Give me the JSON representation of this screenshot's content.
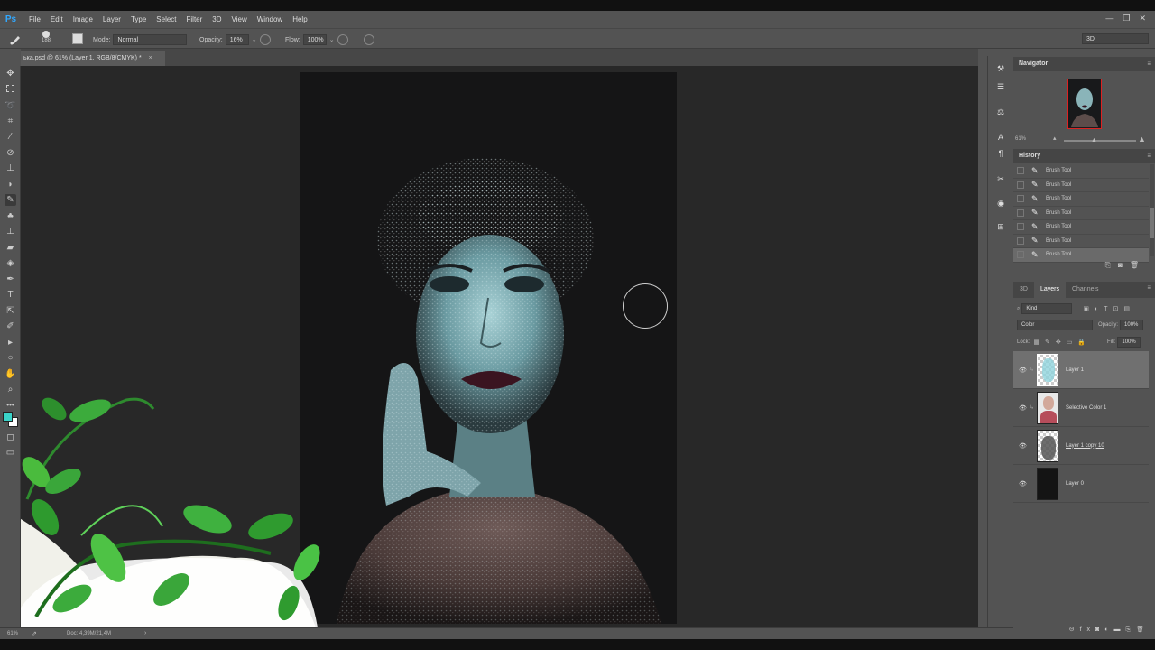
{
  "app": {
    "logo": "Ps"
  },
  "menu": [
    "File",
    "Edit",
    "Image",
    "Layer",
    "Type",
    "Select",
    "Filter",
    "3D",
    "View",
    "Window",
    "Help"
  ],
  "window_controls": {
    "minimize": "—",
    "restore": "❐",
    "close": "✕"
  },
  "options": {
    "brush_size": "188",
    "mode_label": "Mode:",
    "mode_value": "Normal",
    "opacity_label": "Opacity:",
    "opacity_value": "16%",
    "flow_label": "Flow:",
    "flow_value": "100%",
    "workspace": "3D"
  },
  "document_tab": {
    "title": "ька.psd @ 61% (Layer 1, RGB/8/CMYK) *",
    "close": "×"
  },
  "colors": {
    "foreground": "#3ad3c8",
    "background": "#ffffff",
    "accent_border": "#dd2222"
  },
  "status": {
    "zoom": "61%",
    "doc_info": "Doc: 4,39M/21,4M"
  },
  "navigator": {
    "title": "Navigator",
    "zoom": "61%"
  },
  "history": {
    "title": "History",
    "items": [
      "Brush Tool",
      "Brush Tool",
      "Brush Tool",
      "Brush Tool",
      "Brush Tool",
      "Brush Tool",
      "Brush Tool"
    ],
    "current_index": 6
  },
  "layers_panel": {
    "tabs": [
      "3D",
      "Layers",
      "Channels"
    ],
    "active_tab": "Layers",
    "filter_kind": "Kind",
    "blend_mode": "Color",
    "opacity_label": "Opacity:",
    "opacity_value": "100%",
    "lock_label": "Lock:",
    "fill_label": "Fill:",
    "fill_value": "100%",
    "layers": [
      {
        "name": "Layer 1",
        "selected": true
      },
      {
        "name": "Selective Color 1",
        "selected": false
      },
      {
        "name": "Layer 1 copy 10",
        "selected": false
      },
      {
        "name": "Layer 0",
        "selected": false
      }
    ]
  },
  "icons": {
    "tools": [
      "move-icon",
      "marquee-icon",
      "lasso-icon",
      "crop-icon",
      "eyedropper-icon",
      "spot-heal-icon",
      "brush-icon",
      "clone-stamp-icon",
      "history-brush-icon",
      "eraser-icon",
      "gradient-icon",
      "blur-icon",
      "dodge-icon",
      "pen-icon",
      "type-icon",
      "path-select-icon",
      "shape-icon",
      "hand-icon",
      "zoom-icon",
      "more-icon"
    ],
    "dock": [
      "tool-presets-icon",
      "adjustments-icon",
      "properties-icon",
      "character-icon",
      "paragraph-icon",
      "brush-presets-icon",
      "clone-source-icon",
      "actions-icon"
    ]
  }
}
